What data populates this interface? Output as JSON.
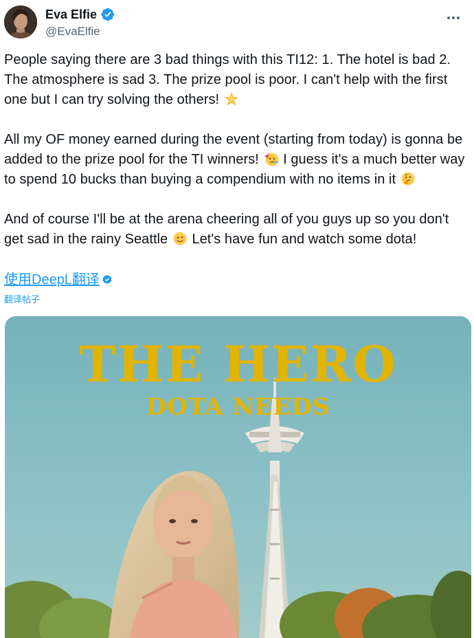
{
  "author": {
    "display_name": "Eva Elfie",
    "handle": "@EvaElfie",
    "verified": true
  },
  "icons": {
    "verified": "verified-badge-icon",
    "more": "more-options-icon",
    "deepl": "deepl-verified-icon",
    "emoji_star": "glowing-star-emoji",
    "emoji_party": "partying-face-emoji",
    "emoji_thinking": "thinking-face-emoji",
    "emoji_wink": "winking-face-emoji"
  },
  "post": {
    "paragraph1": "People saying there are 3 bad things with this TI12: 1. The hotel is bad 2. The atmosphere is sad 3. The prize pool is poor. I can't help with the first one but I can try solving the others!",
    "paragraph2_a": "All my OF money earned during the event (starting from today) is gonna be added to the prize pool for the TI winners!",
    "paragraph2_b": "I guess it's a much better way to spend 10 bucks than buying a compendium with no items in it",
    "paragraph3_a": "And of course I'll be at the arena cheering all of you guys up so you don't get sad in the rainy Seattle",
    "paragraph3_b": "Let's have fun and watch some dota!"
  },
  "translate": {
    "deepl_link": "使用DeepL翻译",
    "translate_post": "翻译帖子"
  },
  "media": {
    "title": "THE HERO",
    "subtitle": "DOTA NEEDS"
  },
  "colors": {
    "link": "#1d9bf0",
    "text": "#0f1419",
    "secondary": "#536471",
    "poster_yellow": "#e0b400",
    "sky": "#8ac0c6"
  }
}
